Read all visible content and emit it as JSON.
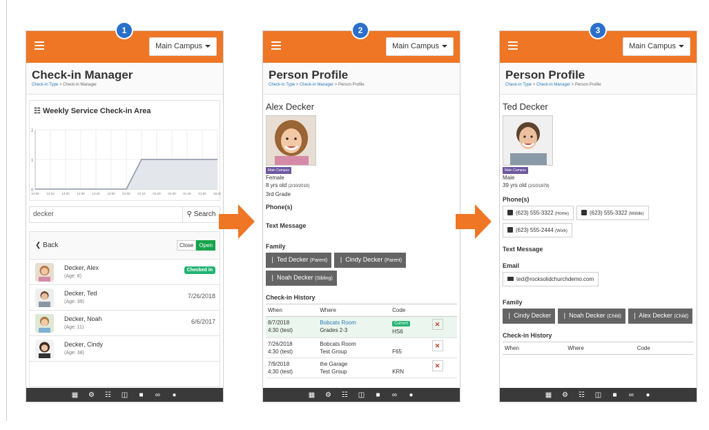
{
  "common": {
    "campus": "Main Campus",
    "nav_icons": [
      "grid-icon",
      "gear-icon",
      "sitemap-icon",
      "columns-icon",
      "lock-icon",
      "link-icon",
      "info-icon"
    ]
  },
  "panel1": {
    "step": "1",
    "title": "Check-in Manager",
    "crumb_link": "Check-in Type",
    "crumb_sep": " > ",
    "crumb_current": "Check-in Manager",
    "chart_title": "Weekly Service Check-in Area",
    "search_value": "decker",
    "search_button": "Search",
    "back_label": "Back",
    "toggle_off": "Close",
    "toggle_on": "Open",
    "people": [
      {
        "name": "Decker, Alex",
        "age": "(Age: 8)",
        "status": "Checked In"
      },
      {
        "name": "Decker, Ted",
        "age": "(Age: 39)",
        "date": "7/26/2018"
      },
      {
        "name": "Decker, Noah",
        "age": "(Age: 11)",
        "date": "6/6/2017"
      },
      {
        "name": "Decker, Cindy",
        "age": "(Age: 38)"
      }
    ]
  },
  "chart_data": {
    "type": "area",
    "title": "Weekly Service Check-in Area",
    "x": [
      "12:00",
      "12:10",
      "12:20",
      "12:30",
      "12:40",
      "12:50",
      "01:00",
      "01:10",
      "01:20",
      "01:30",
      "01:40",
      "01:50",
      "02:00"
    ],
    "values": [
      0,
      0,
      0,
      0,
      0,
      0,
      0,
      1,
      1,
      1,
      1,
      1,
      1
    ],
    "ylim": [
      0,
      2
    ],
    "yticks": [
      "2",
      "1",
      "0"
    ],
    "grid": true
  },
  "panel2": {
    "step": "2",
    "title": "Person Profile",
    "crumb_a": "Check-in Type",
    "crumb_b": "Check-in Manager",
    "crumb_current": "Person Profile",
    "name": "Alex Decker",
    "campus_tag": "Main Campus",
    "gender": "Female",
    "age": "8 yrs old",
    "birth": "(2/10/2010)",
    "grade": "3rd Grade",
    "phones_label": "Phone(s)",
    "text_message_label": "Text Message",
    "family_label": "Family",
    "family": [
      {
        "name": "Ted Decker",
        "rel": "(Parent)"
      },
      {
        "name": "Cindy Decker",
        "rel": "(Parent)"
      },
      {
        "name": "Noah Decker",
        "rel": "(Sibling)"
      }
    ],
    "history_label": "Check-in History",
    "cols": [
      "When",
      "Where",
      "Code"
    ],
    "history": [
      {
        "date": "8/7/2018",
        "time": "4:30 (test)",
        "where": "Bobcats Room",
        "group": "Grades 2-3",
        "badge": "Current",
        "code": "HS6"
      },
      {
        "date": "7/26/2018",
        "time": "4:30 (test)",
        "where": "Bobcats Room",
        "group": "Test Group",
        "code": "F65"
      },
      {
        "date": "7/9/2018",
        "time": "4:30 (test)",
        "where": "the Garage",
        "group": "Test Group",
        "code": "KRN"
      }
    ]
  },
  "panel3": {
    "step": "3",
    "title": "Person Profile",
    "crumb_a": "Check-in Type",
    "crumb_b": "Check-in Manager",
    "crumb_current": "Person Profile",
    "name": "Ted Decker",
    "campus_tag": "Main Campus",
    "gender": "Male",
    "age": "39 yrs old",
    "birth": "(2/10/1979)",
    "phones_label": "Phone(s)",
    "phones": [
      {
        "number": "(623) 555-3322",
        "type": "(Home)"
      },
      {
        "number": "(623) 555-3322",
        "type": "(Mobile)"
      },
      {
        "number": "(623) 555-2444",
        "type": "(Work)"
      }
    ],
    "text_message_label": "Text Message",
    "email_label": "Email",
    "email": "ted@rocksolidchurchdemo.com",
    "family_label": "Family",
    "family": [
      {
        "name": "Cindy Decker",
        "rel": ""
      },
      {
        "name": "Noah Decker",
        "rel": "(Child)"
      },
      {
        "name": "Alex Decker",
        "rel": "(Child)"
      }
    ],
    "history_label": "Check-in History",
    "cols": [
      "When",
      "Where",
      "Code"
    ]
  },
  "colors": {
    "topbar": "#ee7625",
    "arrow": "#ee7625",
    "badge": "#2a6fc9",
    "success": "#22b373",
    "campus_tag": "#6c57a0"
  }
}
